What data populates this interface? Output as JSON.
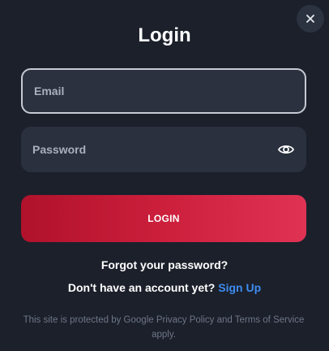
{
  "modal": {
    "title": "Login",
    "close_icon": "close-icon"
  },
  "form": {
    "email": {
      "value": "",
      "placeholder": "Email"
    },
    "password": {
      "value": "",
      "placeholder": "Password",
      "toggle_icon": "eye-icon"
    },
    "login_label": "LOGIN"
  },
  "links": {
    "forgot_password": "Forgot your password?",
    "no_account": "Don't have an account yet?",
    "sign_up": "Sign Up"
  },
  "legal": {
    "text": "This site is protected by Google Privacy Policy and Terms of Service apply."
  },
  "colors": {
    "background": "#1b202b",
    "accent": "#cc1f3c",
    "link": "#3d8cf0"
  }
}
